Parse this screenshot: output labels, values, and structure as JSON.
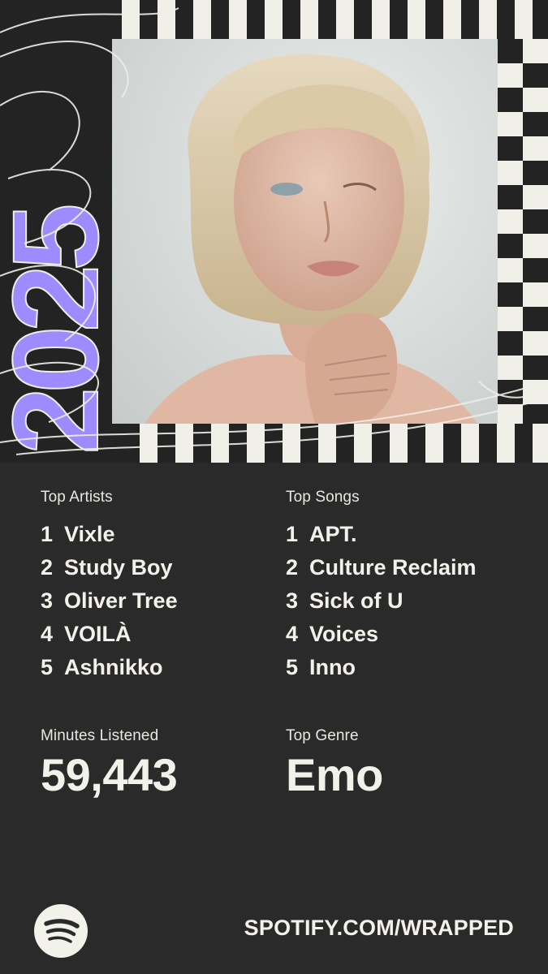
{
  "art": {
    "year_text": "2025"
  },
  "top_artists": {
    "label": "Top Artists",
    "items": [
      {
        "rank": "1",
        "name": "Vixle"
      },
      {
        "rank": "2",
        "name": "Study Boy"
      },
      {
        "rank": "3",
        "name": "Oliver Tree"
      },
      {
        "rank": "4",
        "name": "VOILÀ"
      },
      {
        "rank": "5",
        "name": "Ashnikko"
      }
    ]
  },
  "top_songs": {
    "label": "Top Songs",
    "items": [
      {
        "rank": "1",
        "name": "APT."
      },
      {
        "rank": "2",
        "name": "Culture Reclaim"
      },
      {
        "rank": "3",
        "name": "Sick of U"
      },
      {
        "rank": "4",
        "name": "Voices"
      },
      {
        "rank": "5",
        "name": "Inno"
      }
    ]
  },
  "minutes": {
    "label": "Minutes Listened",
    "value": "59,443"
  },
  "genre": {
    "label": "Top Genre",
    "value": "Emo"
  },
  "footer": {
    "link": "SPOTIFY.COM/WRAPPED",
    "logo_icon": "spotify-logo-icon"
  },
  "colors": {
    "background": "#2a2a2a",
    "text": "#f2f1ea",
    "accent": "#9c8cff",
    "stripe_light": "#f0efe8",
    "stripe_dark": "#232323"
  }
}
